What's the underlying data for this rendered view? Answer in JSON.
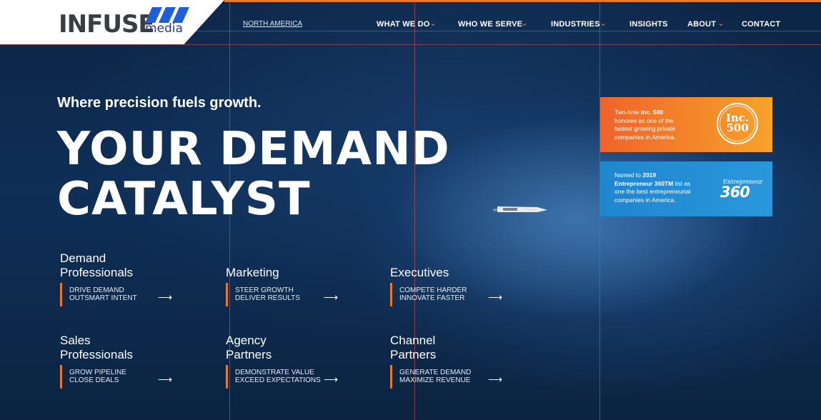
{
  "brand": {
    "name": "INFUSE",
    "sub": "media",
    "stripe_color": "#1e5fd6"
  },
  "region_link": "NORTH AMERICA",
  "nav": [
    {
      "label": "WHAT WE DO",
      "dropdown": true
    },
    {
      "label": "WHO WE SERVE",
      "dropdown": true
    },
    {
      "label": "INDUSTRIES",
      "dropdown": true
    },
    {
      "label": "INSIGHTS",
      "dropdown": false
    },
    {
      "label": "ABOUT",
      "dropdown": true
    },
    {
      "label": "CONTACT",
      "dropdown": false
    }
  ],
  "icons": {
    "chevron": "⌄",
    "arrow": "⟶"
  },
  "hero": {
    "tagline": "Where precision fuels growth.",
    "title_line1": "YOUR DEMAND",
    "title_line2": "CATALYST"
  },
  "awards": {
    "inc": {
      "pre": "Two-time ",
      "bold": "Inc. 500",
      "rest1": "honoree as one of the",
      "rest2": "fastest growing private",
      "rest3": "companies in America.",
      "seal_top": "Inc.",
      "seal_num": "500"
    },
    "ent": {
      "pre": "Named to ",
      "bold1": "2019",
      "bold2": "Entrepreneur 360TM",
      "rest1": " list as",
      "rest2": "one the best entrepreneurial",
      "rest3": "companies in America.",
      "logo_small": "Entrepreneur",
      "logo_big": "360"
    }
  },
  "audiences": [
    {
      "title1": "Demand",
      "title2": "Professionals",
      "line1": "DRIVE DEMAND",
      "line2": "OUTSMART INTENT"
    },
    {
      "title1": "",
      "title2": "Marketing",
      "line1": "STEER GROWTH",
      "line2": "DELIVER RESULTS"
    },
    {
      "title1": "",
      "title2": "Executives",
      "line1": "COMPETE HARDER",
      "line2": "INNOVATE FASTER"
    },
    {
      "title1": "Sales",
      "title2": "Professionals",
      "line1": "GROW PIPELINE",
      "line2": "CLOSE DEALS"
    },
    {
      "title1": "Agency",
      "title2": "Partners",
      "line1": "DEMONSTRATE VALUE",
      "line2": "EXCEED EXPECTATIONS"
    },
    {
      "title1": "Channel",
      "title2": "Partners",
      "line1": "GENERATE DEMAND",
      "line2": "MAXIMIZE REVENUE"
    }
  ],
  "colors": {
    "accent": "#e8792b",
    "inc_from": "#f0632a",
    "inc_to": "#f7a32a",
    "ent": "#2a97db",
    "bg": "#0f2f57"
  }
}
